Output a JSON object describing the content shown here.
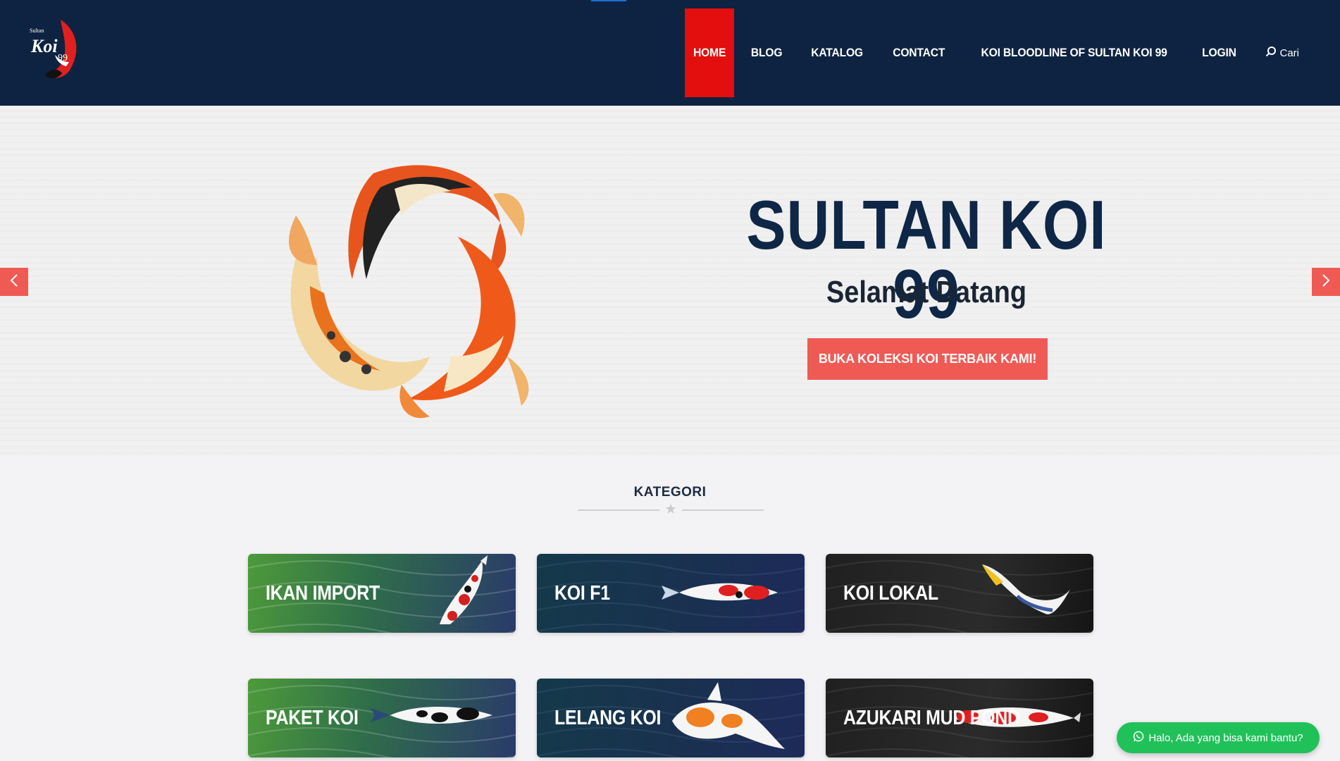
{
  "brand": {
    "name": "Sultan Koi 99",
    "logo_small_text": "Sultan",
    "logo_main_text": "Koi",
    "logo_number": "99",
    "primary_color": "#0d2341",
    "accent_color": "#e30e0e",
    "cta_color": "#f05a55"
  },
  "nav": {
    "items": [
      {
        "label": "HOME",
        "active": true
      },
      {
        "label": "BLOG",
        "active": false
      },
      {
        "label": "KATALOG",
        "active": false
      },
      {
        "label": "CONTACT",
        "active": false
      },
      {
        "label": "KOI BLOODLINE OF SULTAN KOI 99",
        "active": false
      },
      {
        "label": "LOGIN",
        "active": false
      }
    ],
    "search_label": "Cari",
    "search_icon": "search-icon"
  },
  "hero": {
    "title": "SULTAN KOI 99",
    "subtitle": "Selamat Datang",
    "cta_label": "BUKA KOLEKSI KOI TERBAIK KAMI!",
    "prev_icon": "chevron-left-icon",
    "next_icon": "chevron-right-icon"
  },
  "kategori": {
    "title": "KATEGORI",
    "divider_icon": "star-icon",
    "cards": [
      {
        "label": "IKAN IMPORT",
        "theme": "green",
        "fish": "kohaku-showa"
      },
      {
        "label": "KOI F1",
        "theme": "teal",
        "fish": "sanke"
      },
      {
        "label": "KOI LOKAL",
        "theme": "dark",
        "fish": "yamabuki"
      },
      {
        "label": "PAKET KOI",
        "theme": "green",
        "fish": "shiro-utsuri"
      },
      {
        "label": "LELANG KOI",
        "theme": "teal",
        "fish": "ochiba"
      },
      {
        "label": "AZUKARI MUD POND",
        "theme": "dark",
        "fish": "kohaku"
      }
    ]
  },
  "chat": {
    "label": "Halo, Ada yang bisa kami bantu?",
    "icon": "whatsapp-icon"
  }
}
